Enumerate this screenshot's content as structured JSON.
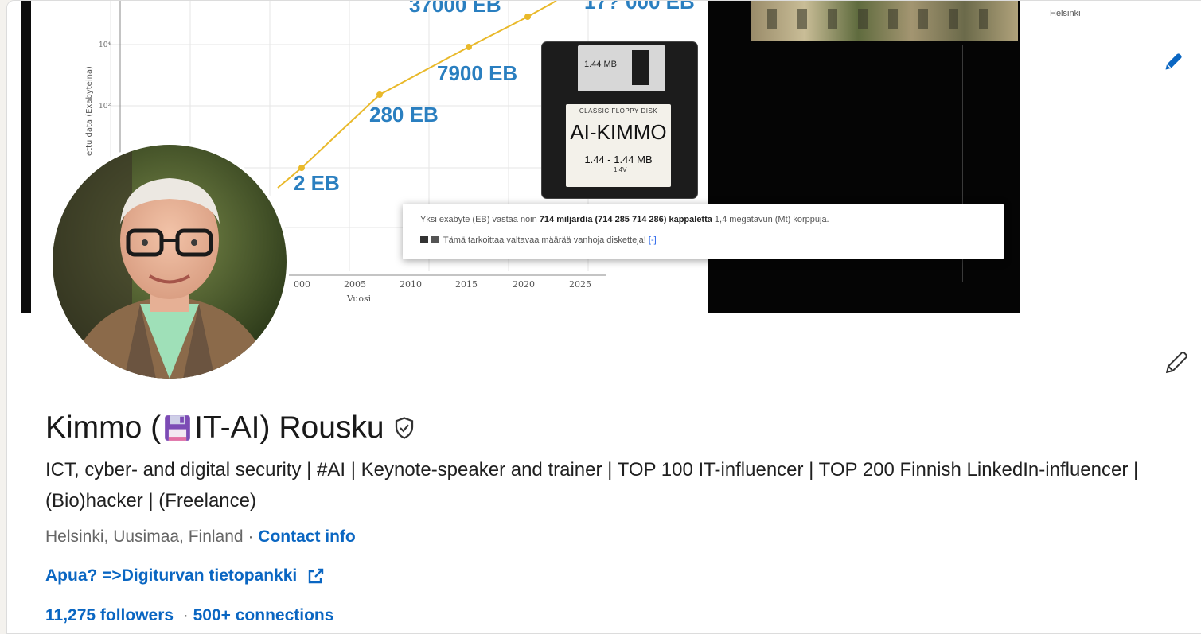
{
  "banner": {
    "chart": {
      "y_axis_label": "ettu data (Exabyteina)",
      "x_axis_label": "Vuosi",
      "y_ticks": [
        "10⁴",
        "10²"
      ],
      "x_ticks": [
        "000",
        "2005",
        "2010",
        "2015",
        "2020",
        "2025"
      ],
      "point_labels": [
        "2 EB",
        "280 EB",
        "7900 EB",
        "37000 EB",
        "17? 000 EB"
      ]
    },
    "floppy": {
      "shutter_text": "1.44 MB",
      "label_top": "CLASSIC FLOPPY DISK",
      "label_main": "AI-KIMMO",
      "label_line": "1.44 - 1.44 MB",
      "label_sub": "1.4V"
    },
    "tooltip": {
      "line1_pre": "Yksi exabyte (EB) vastaa noin ",
      "line1_bold1": "714 miljardia (714 285 714 286) kappaletta",
      "line1_post": " 1,4 megatavun (Mt) korppuja.",
      "line2_text": "Tämä tarkoittaa valtavaa määrää vanhoja disketteja!",
      "line2_link": "[-]"
    },
    "corner_text": "Helsinki"
  },
  "profile": {
    "name_prefix": "Kimmo (",
    "name_suffix": " IT-AI) Rousku",
    "headline": "ICT, cyber- and digital security | #AI | Keynote-speaker and trainer | TOP 100 IT-influencer | TOP 200 Finnish LinkedIn-influencer | (Bio)hacker | (Freelance)",
    "location": "Helsinki, Uusimaa, Finland",
    "separator": " · ",
    "contact_info": "Contact info",
    "external_link": "Apua? =>Digiturvan tietopankki",
    "followers": "11,275 followers",
    "connections": "500+ connections"
  },
  "colors": {
    "link": "#0a66c2",
    "text": "#191919"
  },
  "icons": [
    "pencil-icon",
    "floppy-disk-icon",
    "verified-shield-icon",
    "external-link-icon"
  ]
}
